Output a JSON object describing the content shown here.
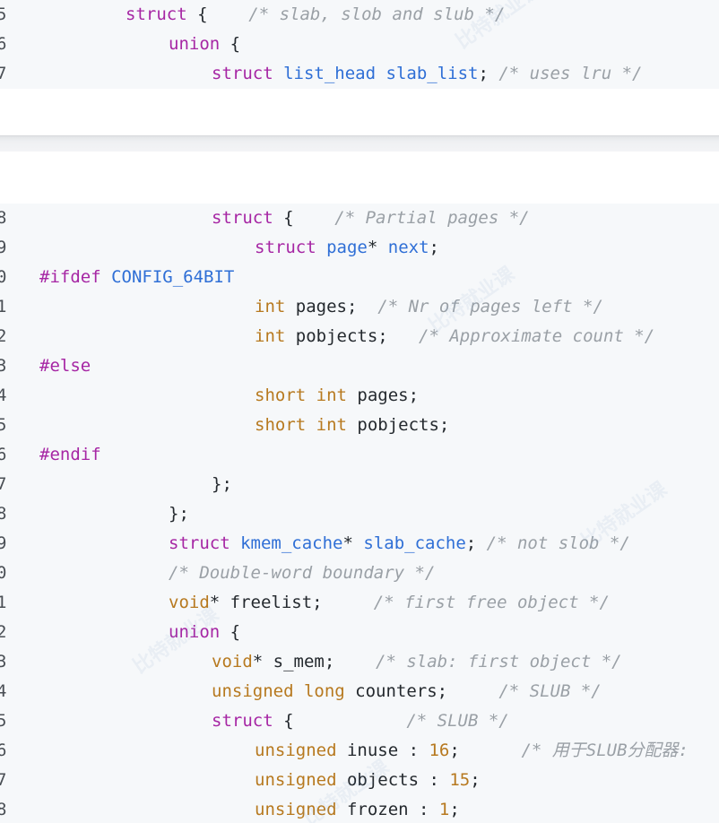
{
  "watermark": {
    "text": "比特就业课",
    "color": "#9ec3e6"
  },
  "colors": {
    "keyword": "#a626a4",
    "type": "#b7791f",
    "identifier": "#2f6fd6",
    "comment": "#9aa0a6",
    "background": "#f6f8fa"
  },
  "top_lines": [
    {
      "ln": "5",
      "indent": 140,
      "tokens": [
        [
          "kw",
          "struct"
        ],
        [
          "p",
          " { "
        ],
        [
          "cm",
          "   /* slab, slob and slub */"
        ]
      ]
    },
    {
      "ln": "6",
      "indent": 188,
      "tokens": [
        [
          "kw",
          "union"
        ],
        [
          "p",
          " {"
        ]
      ]
    },
    {
      "ln": "7",
      "indent": 236,
      "tokens": [
        [
          "kw",
          "struct"
        ],
        [
          "p",
          " "
        ],
        [
          "fn",
          "list_head"
        ],
        [
          "p",
          " "
        ],
        [
          "fn",
          "slab_list"
        ],
        [
          "p",
          ";"
        ],
        [
          "cm",
          " /* uses lru */"
        ]
      ]
    }
  ],
  "bottom_lines": [
    {
      "ln": "8",
      "indent": 236,
      "tokens": [
        [
          "kw",
          "struct"
        ],
        [
          "p",
          " { "
        ],
        [
          "cm",
          "   /* Partial pages */"
        ]
      ]
    },
    {
      "ln": "9",
      "indent": 284,
      "tokens": [
        [
          "kw",
          "struct"
        ],
        [
          "p",
          " "
        ],
        [
          "fn",
          "page"
        ],
        [
          "p",
          "* "
        ],
        [
          "fn",
          "next"
        ],
        [
          "p",
          ";"
        ]
      ]
    },
    {
      "ln": "0",
      "indent": 44,
      "tokens": [
        [
          "pp",
          "#ifdef"
        ],
        [
          "p",
          " "
        ],
        [
          "fn",
          "CONFIG_64BIT"
        ]
      ]
    },
    {
      "ln": "1",
      "indent": 284,
      "tokens": [
        [
          "ty",
          "int"
        ],
        [
          "p",
          " pages;  "
        ],
        [
          "cm",
          "/* Nr of pages left */"
        ]
      ]
    },
    {
      "ln": "2",
      "indent": 284,
      "tokens": [
        [
          "ty",
          "int"
        ],
        [
          "p",
          " pobjects;   "
        ],
        [
          "cm",
          "/* Approximate count */"
        ]
      ]
    },
    {
      "ln": "3",
      "indent": 44,
      "tokens": [
        [
          "pp",
          "#else"
        ]
      ]
    },
    {
      "ln": "4",
      "indent": 284,
      "tokens": [
        [
          "ty",
          "short"
        ],
        [
          "p",
          " "
        ],
        [
          "ty",
          "int"
        ],
        [
          "p",
          " pages;"
        ]
      ]
    },
    {
      "ln": "5",
      "indent": 284,
      "tokens": [
        [
          "ty",
          "short"
        ],
        [
          "p",
          " "
        ],
        [
          "ty",
          "int"
        ],
        [
          "p",
          " pobjects;"
        ]
      ]
    },
    {
      "ln": "6",
      "indent": 44,
      "tokens": [
        [
          "pp",
          "#endif"
        ]
      ]
    },
    {
      "ln": "7",
      "indent": 236,
      "tokens": [
        [
          "p",
          "};"
        ]
      ]
    },
    {
      "ln": "8",
      "indent": 188,
      "tokens": [
        [
          "p",
          "};"
        ]
      ]
    },
    {
      "ln": "9",
      "indent": 188,
      "tokens": [
        [
          "kw",
          "struct"
        ],
        [
          "p",
          " "
        ],
        [
          "fn",
          "kmem_cache"
        ],
        [
          "p",
          "* "
        ],
        [
          "fn",
          "slab_cache"
        ],
        [
          "p",
          "; "
        ],
        [
          "cm",
          "/* not slob */"
        ]
      ]
    },
    {
      "ln": "0",
      "indent": 188,
      "tokens": [
        [
          "cm",
          "/* Double-word boundary */"
        ]
      ]
    },
    {
      "ln": "1",
      "indent": 188,
      "tokens": [
        [
          "ty",
          "void"
        ],
        [
          "p",
          "* freelist;     "
        ],
        [
          "cm",
          "/* first free object */"
        ]
      ]
    },
    {
      "ln": "2",
      "indent": 188,
      "tokens": [
        [
          "kw",
          "union"
        ],
        [
          "p",
          " {"
        ]
      ]
    },
    {
      "ln": "3",
      "indent": 236,
      "tokens": [
        [
          "ty",
          "void"
        ],
        [
          "p",
          "* s_mem;    "
        ],
        [
          "cm",
          "/* slab: first object */"
        ]
      ]
    },
    {
      "ln": "4",
      "indent": 236,
      "tokens": [
        [
          "ty",
          "unsigned"
        ],
        [
          "p",
          " "
        ],
        [
          "ty",
          "long"
        ],
        [
          "p",
          " counters;     "
        ],
        [
          "cm",
          "/* SLUB */"
        ]
      ]
    },
    {
      "ln": "5",
      "indent": 236,
      "tokens": [
        [
          "kw",
          "struct"
        ],
        [
          "p",
          " {           "
        ],
        [
          "cm",
          "/* SLUB */"
        ]
      ]
    },
    {
      "ln": "6",
      "indent": 284,
      "tokens": [
        [
          "ty",
          "unsigned"
        ],
        [
          "p",
          " inuse : "
        ],
        [
          "nu",
          "16"
        ],
        [
          "p",
          ";      "
        ],
        [
          "cm",
          "/* 用于SLUB分配器:"
        ]
      ]
    },
    {
      "ln": "7",
      "indent": 284,
      "tokens": [
        [
          "ty",
          "unsigned"
        ],
        [
          "p",
          " objects : "
        ],
        [
          "nu",
          "15"
        ],
        [
          "p",
          ";"
        ]
      ]
    },
    {
      "ln": "8",
      "indent": 284,
      "tokens": [
        [
          "ty",
          "unsigned"
        ],
        [
          "p",
          " frozen : "
        ],
        [
          "nu",
          "1"
        ],
        [
          "p",
          ";"
        ]
      ]
    }
  ]
}
